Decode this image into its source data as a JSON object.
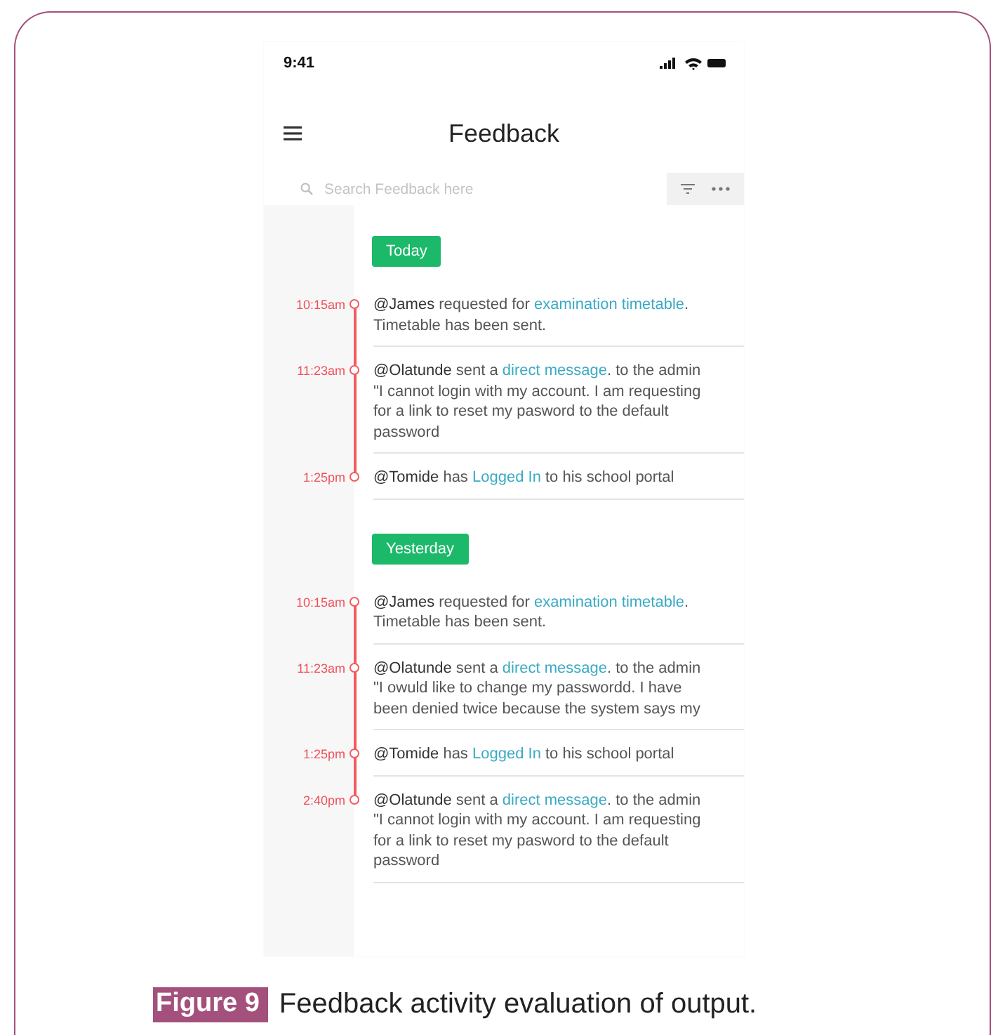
{
  "status_bar": {
    "time": "9:41"
  },
  "header": {
    "title": "Feedback"
  },
  "search": {
    "placeholder": "Search Feedback here"
  },
  "groups": [
    {
      "label": "Today",
      "entries": [
        {
          "time": "10:15am",
          "message": [
            {
              "kind": "user",
              "text": "@James"
            },
            {
              "kind": "plain",
              "text": " requested for "
            },
            {
              "kind": "link",
              "text": "examination timetable"
            },
            {
              "kind": "plain",
              "text": "."
            }
          ],
          "body": "Timetable has been sent."
        },
        {
          "time": "11:23am",
          "message": [
            {
              "kind": "user",
              "text": "@Olatunde"
            },
            {
              "kind": "plain",
              "text": " sent a "
            },
            {
              "kind": "link",
              "text": "direct message"
            },
            {
              "kind": "plain",
              "text": ". to the admin"
            }
          ],
          "body": "\"I cannot login with my account. I am requesting for a link to reset my pasword to the default password"
        },
        {
          "time": "1:25pm",
          "message": [
            {
              "kind": "user",
              "text": "@Tomide"
            },
            {
              "kind": "plain",
              "text": " has "
            },
            {
              "kind": "link",
              "text": "Logged In"
            },
            {
              "kind": "plain",
              "text": " to his school portal"
            }
          ]
        }
      ]
    },
    {
      "label": "Yesterday",
      "entries": [
        {
          "time": "10:15am",
          "message": [
            {
              "kind": "user",
              "text": "@James"
            },
            {
              "kind": "plain",
              "text": " requested for "
            },
            {
              "kind": "link",
              "text": "examination timetable"
            },
            {
              "kind": "plain",
              "text": "."
            }
          ],
          "body": "Timetable has been sent."
        },
        {
          "time": "11:23am",
          "message": [
            {
              "kind": "user",
              "text": "@Olatunde"
            },
            {
              "kind": "plain",
              "text": " sent a "
            },
            {
              "kind": "link",
              "text": "direct message"
            },
            {
              "kind": "plain",
              "text": ". to the admin"
            }
          ],
          "body": "\"I owuld like to change my passwordd. I have been denied twice because the system says my"
        },
        {
          "time": "1:25pm",
          "message": [
            {
              "kind": "user",
              "text": "@Tomide"
            },
            {
              "kind": "plain",
              "text": " has "
            },
            {
              "kind": "link",
              "text": "Logged In"
            },
            {
              "kind": "plain",
              "text": " to his school portal"
            }
          ]
        },
        {
          "time": "2:40pm",
          "message": [
            {
              "kind": "user",
              "text": "@Olatunde"
            },
            {
              "kind": "plain",
              "text": " sent a "
            },
            {
              "kind": "link",
              "text": "direct message"
            },
            {
              "kind": "plain",
              "text": ". to the admin"
            }
          ],
          "body": "\"I cannot login with my account. I am requesting for a link to reset my pasword to the default password"
        }
      ]
    }
  ],
  "figure": {
    "label": "Figure 9",
    "caption": "Feedback activity evaluation of output."
  }
}
